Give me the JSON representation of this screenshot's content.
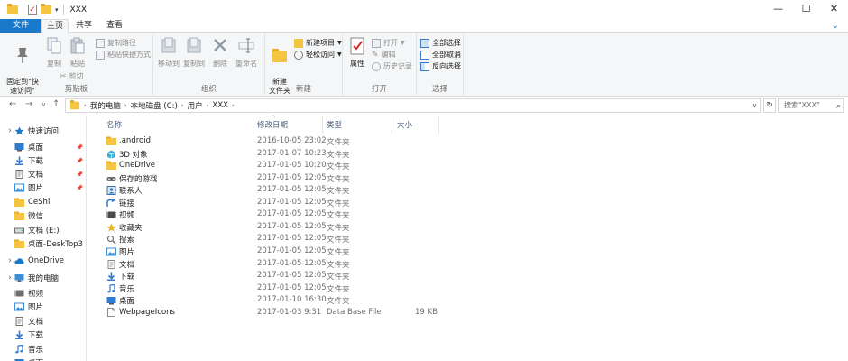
{
  "window": {
    "title": "XXX",
    "controls": [
      "—",
      "☐",
      "✕"
    ]
  },
  "tabs": {
    "file": "文件",
    "home": "主页",
    "share": "共享",
    "view": "查看"
  },
  "ribbon": {
    "clipboard": {
      "label": "剪贴板",
      "pin": "固定到\"快\n速访问\"",
      "copy": "复制",
      "paste": "粘贴",
      "cut": "剪切",
      "copy_path": "复制路径",
      "paste_shortcut": "粘贴快捷方式"
    },
    "organize": {
      "label": "组织",
      "move_to": "移动到",
      "copy_to": "复制到",
      "delete": "删除",
      "rename": "重命名"
    },
    "new": {
      "label": "新建",
      "new_folder": "新建\n文件夹",
      "new_item": "新建项目",
      "easy_access": "轻松访问"
    },
    "open": {
      "label": "打开",
      "properties": "属性",
      "open": "打开",
      "edit": "编辑",
      "history": "历史记录"
    },
    "select": {
      "label": "选择",
      "select_all": "全部选择",
      "select_none": "全部取消",
      "invert": "反向选择"
    }
  },
  "address": {
    "crumbs": [
      "我的电脑",
      "本地磁盘 (C:)",
      "用户",
      "XXX"
    ],
    "search_placeholder": "搜索\"XXX\""
  },
  "navpane": {
    "items": [
      {
        "label": "快速访问",
        "icon": "star-icon",
        "color": "#1979ca",
        "level": 0
      },
      {
        "label": "桌面",
        "icon": "desktop-icon",
        "color": "#2e7bcf",
        "level": 1,
        "pinned": true
      },
      {
        "label": "下载",
        "icon": "download-icon",
        "color": "#2e7bcf",
        "level": 1,
        "pinned": true
      },
      {
        "label": "文档",
        "icon": "document-icon",
        "color": "#6d6d6d",
        "level": 1,
        "pinned": true
      },
      {
        "label": "图片",
        "icon": "picture-icon",
        "color": "#3b8fd6",
        "level": 1,
        "pinned": true
      },
      {
        "label": "CeShi",
        "icon": "folder-icon",
        "color": "#f5c542",
        "level": 1
      },
      {
        "label": "微信",
        "icon": "folder-icon",
        "color": "#f5c542",
        "level": 1
      },
      {
        "label": "文档 (E:)",
        "icon": "drive-icon",
        "color": "#6d6d6d",
        "level": 1
      },
      {
        "label": "桌面-DeskTop3",
        "icon": "folder-icon",
        "color": "#f5c542",
        "level": 1
      },
      {
        "label": "OneDrive",
        "icon": "cloud-icon",
        "color": "#1979ca",
        "level": 0
      },
      {
        "label": "我的电脑",
        "icon": "computer-icon",
        "color": "#3b8fd6",
        "level": 0
      },
      {
        "label": "视频",
        "icon": "video-icon",
        "color": "#6d6d6d",
        "level": 1
      },
      {
        "label": "图片",
        "icon": "picture-icon",
        "color": "#3b8fd6",
        "level": 1
      },
      {
        "label": "文档",
        "icon": "document-icon",
        "color": "#6d6d6d",
        "level": 1
      },
      {
        "label": "下载",
        "icon": "download-icon",
        "color": "#2e7bcf",
        "level": 1
      },
      {
        "label": "音乐",
        "icon": "music-icon",
        "color": "#2e7bcf",
        "level": 1
      },
      {
        "label": "桌面",
        "icon": "desktop-icon",
        "color": "#2e7bcf",
        "level": 1
      }
    ]
  },
  "columns": {
    "name": "名称",
    "modified": "修改日期",
    "type": "类型",
    "size": "大小"
  },
  "files": [
    {
      "name": ".android",
      "modified": "2016-10-05 23:02",
      "type": "文件夹",
      "size": "",
      "icon": "folder-icon",
      "color": "#f5c542"
    },
    {
      "name": "3D 对象",
      "modified": "2017-01-07 10:23",
      "type": "文件夹",
      "size": "",
      "icon": "3d-object-icon",
      "color": "#3bb3d8"
    },
    {
      "name": "OneDrive",
      "modified": "2017-01-05 10:20",
      "type": "文件夹",
      "size": "",
      "icon": "folder-icon",
      "color": "#f5c542"
    },
    {
      "name": "保存的游戏",
      "modified": "2017-01-05 12:05",
      "type": "文件夹",
      "size": "",
      "icon": "saved-games-icon",
      "color": "#6d6d6d"
    },
    {
      "name": "联系人",
      "modified": "2017-01-05 12:05",
      "type": "文件夹",
      "size": "",
      "icon": "contacts-icon",
      "color": "#3b6fb0"
    },
    {
      "name": "链接",
      "modified": "2017-01-05 12:05",
      "type": "文件夹",
      "size": "",
      "icon": "link-icon",
      "color": "#2e7bcf"
    },
    {
      "name": "视频",
      "modified": "2017-01-05 12:05",
      "type": "文件夹",
      "size": "",
      "icon": "video-icon",
      "color": "#4a4a4a"
    },
    {
      "name": "收藏夹",
      "modified": "2017-01-05 12:05",
      "type": "文件夹",
      "size": "",
      "icon": "favorites-icon",
      "color": "#e8b422"
    },
    {
      "name": "搜索",
      "modified": "2017-01-05 12:05",
      "type": "文件夹",
      "size": "",
      "icon": "search-folder-icon",
      "color": "#6d6d6d"
    },
    {
      "name": "图片",
      "modified": "2017-01-05 12:05",
      "type": "文件夹",
      "size": "",
      "icon": "picture-icon",
      "color": "#3b8fd6"
    },
    {
      "name": "文档",
      "modified": "2017-01-05 12:05",
      "type": "文件夹",
      "size": "",
      "icon": "document-icon",
      "color": "#8a8a8a"
    },
    {
      "name": "下载",
      "modified": "2017-01-05 12:05",
      "type": "文件夹",
      "size": "",
      "icon": "download-icon",
      "color": "#2e7bcf"
    },
    {
      "name": "音乐",
      "modified": "2017-01-05 12:05",
      "type": "文件夹",
      "size": "",
      "icon": "music-icon",
      "color": "#2e7bcf"
    },
    {
      "name": "桌面",
      "modified": "2017-01-10 16:30",
      "type": "文件夹",
      "size": "",
      "icon": "desktop-icon",
      "color": "#2e7bcf"
    },
    {
      "name": "WebpageIcons",
      "modified": "2017-01-03 9:31",
      "type": "Data Base File",
      "size": "19 KB",
      "icon": "file-icon",
      "color": "#ffffff"
    }
  ]
}
